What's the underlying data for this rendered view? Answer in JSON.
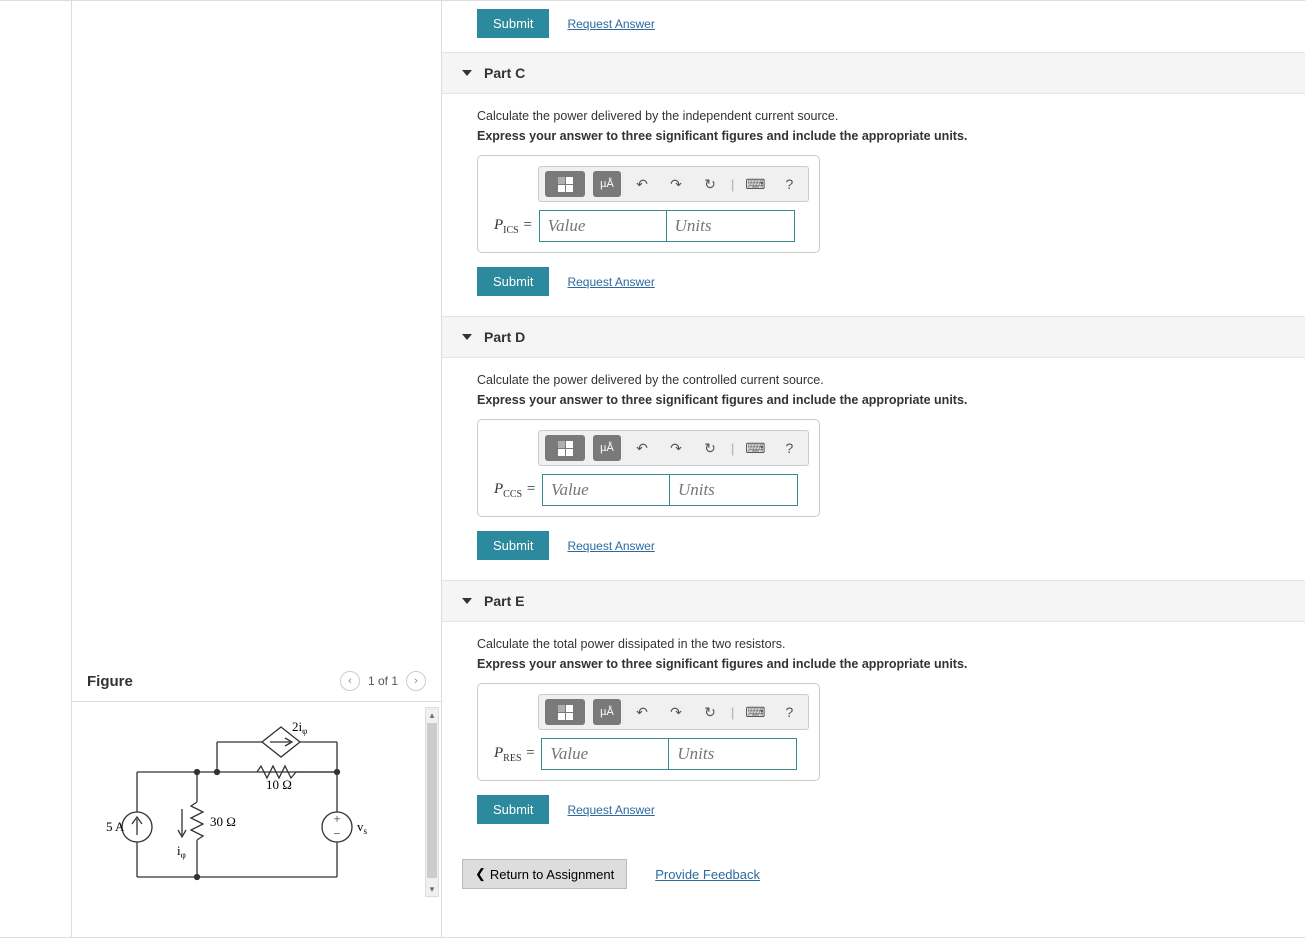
{
  "figure": {
    "title": "Figure",
    "pager": "1 of 1",
    "circuit": {
      "current_source": "5 A",
      "resistor1": "30 Ω",
      "resistor2": "10 Ω",
      "dep_source": "2iφ",
      "branch_current": "iφ",
      "voltage_source": "vs"
    }
  },
  "top_actions": {
    "submit": "Submit",
    "request": "Request Answer"
  },
  "parts": [
    {
      "id": "C",
      "title": "Part C",
      "prompt": "Calculate the power delivered by the independent current source.",
      "instr": "Express your answer to three significant figures and include the appropriate units.",
      "var_sym": "P",
      "var_sub": "ICS",
      "value_ph": "Value",
      "units_ph": "Units",
      "submit": "Submit",
      "request": "Request Answer"
    },
    {
      "id": "D",
      "title": "Part D",
      "prompt": "Calculate the power delivered by the controlled current source.",
      "instr": "Express your answer to three significant figures and include the appropriate units.",
      "var_sym": "P",
      "var_sub": "CCS",
      "value_ph": "Value",
      "units_ph": "Units",
      "submit": "Submit",
      "request": "Request Answer"
    },
    {
      "id": "E",
      "title": "Part E",
      "prompt": "Calculate the total power dissipated in the two resistors.",
      "instr": "Express your answer to three significant figures and include the appropriate units.",
      "var_sym": "P",
      "var_sub": "RES",
      "value_ph": "Value",
      "units_ph": "Units",
      "submit": "Submit",
      "request": "Request Answer"
    }
  ],
  "toolbar": {
    "mu_a": "µÅ",
    "help": "?"
  },
  "footer": {
    "return": "Return to Assignment",
    "feedback": "Provide Feedback"
  }
}
